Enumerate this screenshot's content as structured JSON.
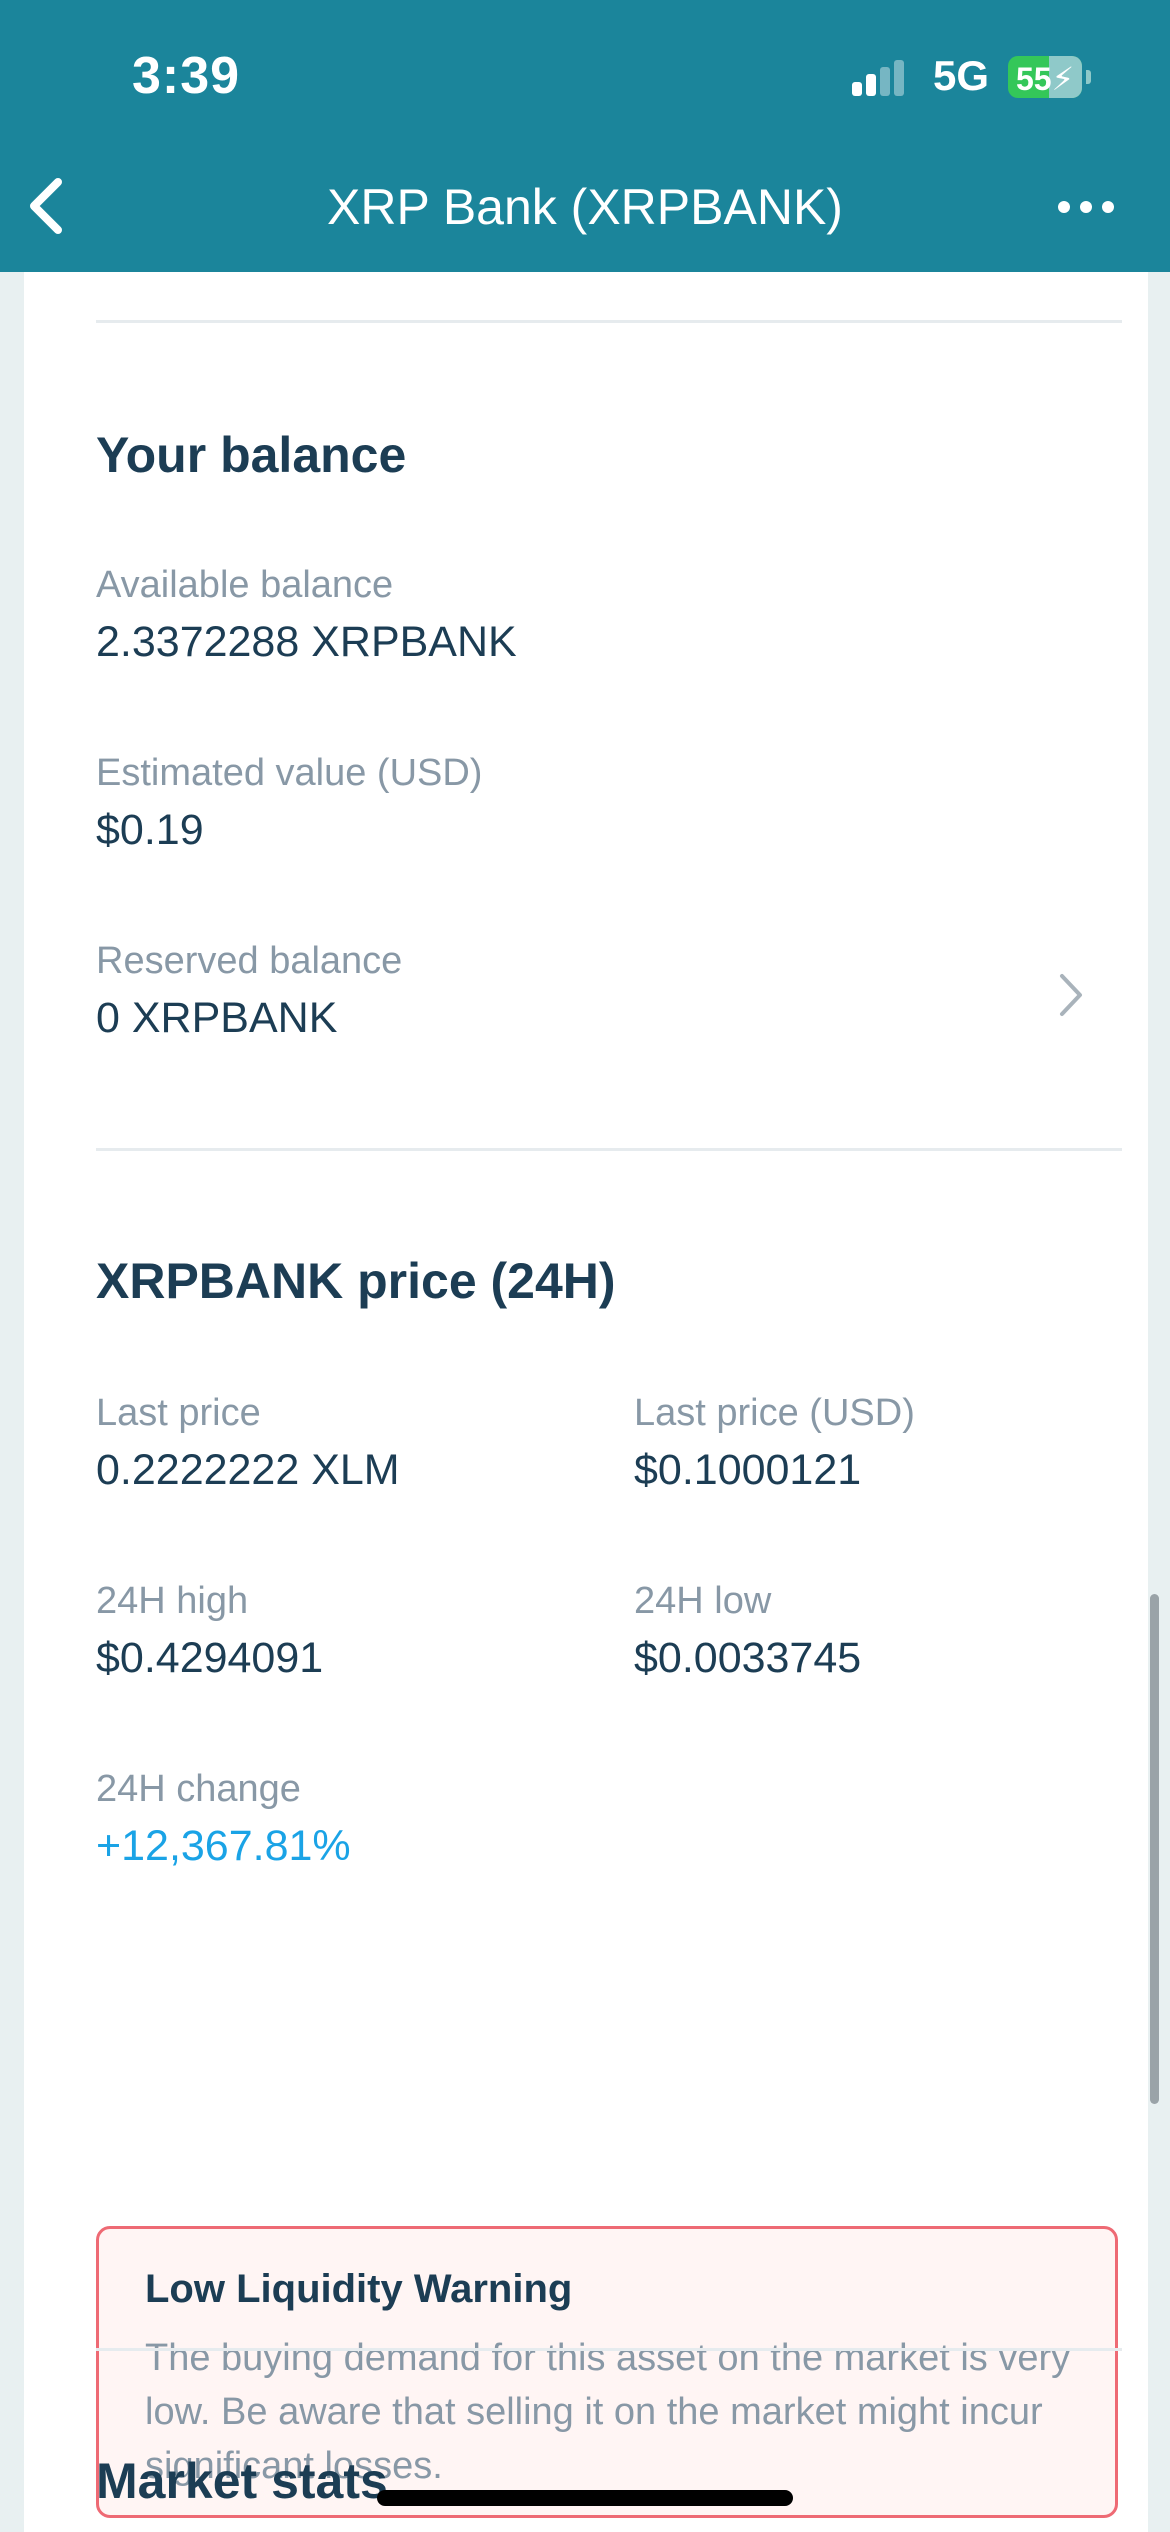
{
  "status_bar": {
    "time": "3:39",
    "network": "5G",
    "battery": "55",
    "battery_level": 0.55,
    "signal_bars_active": 2,
    "signal_bars_total": 4
  },
  "nav": {
    "title": "XRP Bank (XRPBANK)",
    "back_icon": "chevron-left-icon",
    "more_icon": "ellipsis-icon"
  },
  "balance": {
    "title": "Your balance",
    "available_label": "Available balance",
    "available_value": "2.3372288 XRPBANK",
    "estimated_label": "Estimated value (USD)",
    "estimated_value": "$0.19",
    "reserved_label": "Reserved balance",
    "reserved_value": "0 XRPBANK"
  },
  "price": {
    "title": "XRPBANK price (24H)",
    "last_price_label": "Last price",
    "last_price_value": "0.2222222 XLM",
    "last_price_usd_label": "Last price (USD)",
    "last_price_usd_value": "$0.1000121",
    "high_label": "24H high",
    "high_value": "$0.4294091",
    "low_label": "24H low",
    "low_value": "$0.0033745",
    "change_label": "24H change",
    "change_value": "+12,367.81%"
  },
  "warning": {
    "title": "Low Liquidity Warning",
    "text": "The buying demand for this asset on the market is very low. Be aware that selling it on the market might incur significant losses."
  },
  "market_stats": {
    "title": "Market stats"
  },
  "colors": {
    "header": "#1b859b",
    "positive": "#1aa3e6",
    "warning_border": "#ee6a74",
    "warning_bg": "#fff5f4"
  }
}
